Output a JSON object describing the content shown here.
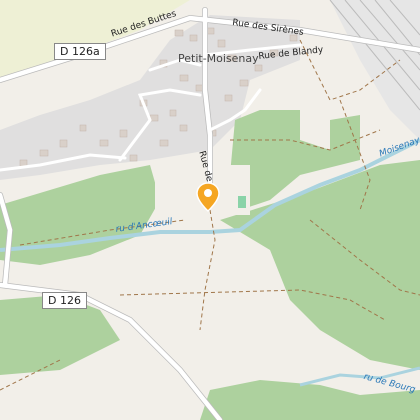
{
  "map": {
    "place": "Petit-Moisenay",
    "place_partial": "Moisenay",
    "roads": {
      "rue_des_buttes": "Rue des Buttes",
      "rue_des_sirenes": "Rue des Sirènes",
      "rue_de_blandy": "Rue de Blandy",
      "rue_de": "Rue de",
      "d126a": "D 126a",
      "d126": "D 126"
    },
    "waterways": {
      "ru_ancoeuil": "ru d'Ancœuil",
      "ru_de_bourg": "ru de Bourg"
    },
    "marker": {
      "icon": "map-pin-icon",
      "color": "#f5a623"
    },
    "colors": {
      "background": "#f2efe9",
      "forest": "#add19e",
      "residential": "#e0dfdf",
      "water": "#aad3df",
      "farmland": "#eef0d5",
      "building": "#d9d0c9"
    }
  }
}
